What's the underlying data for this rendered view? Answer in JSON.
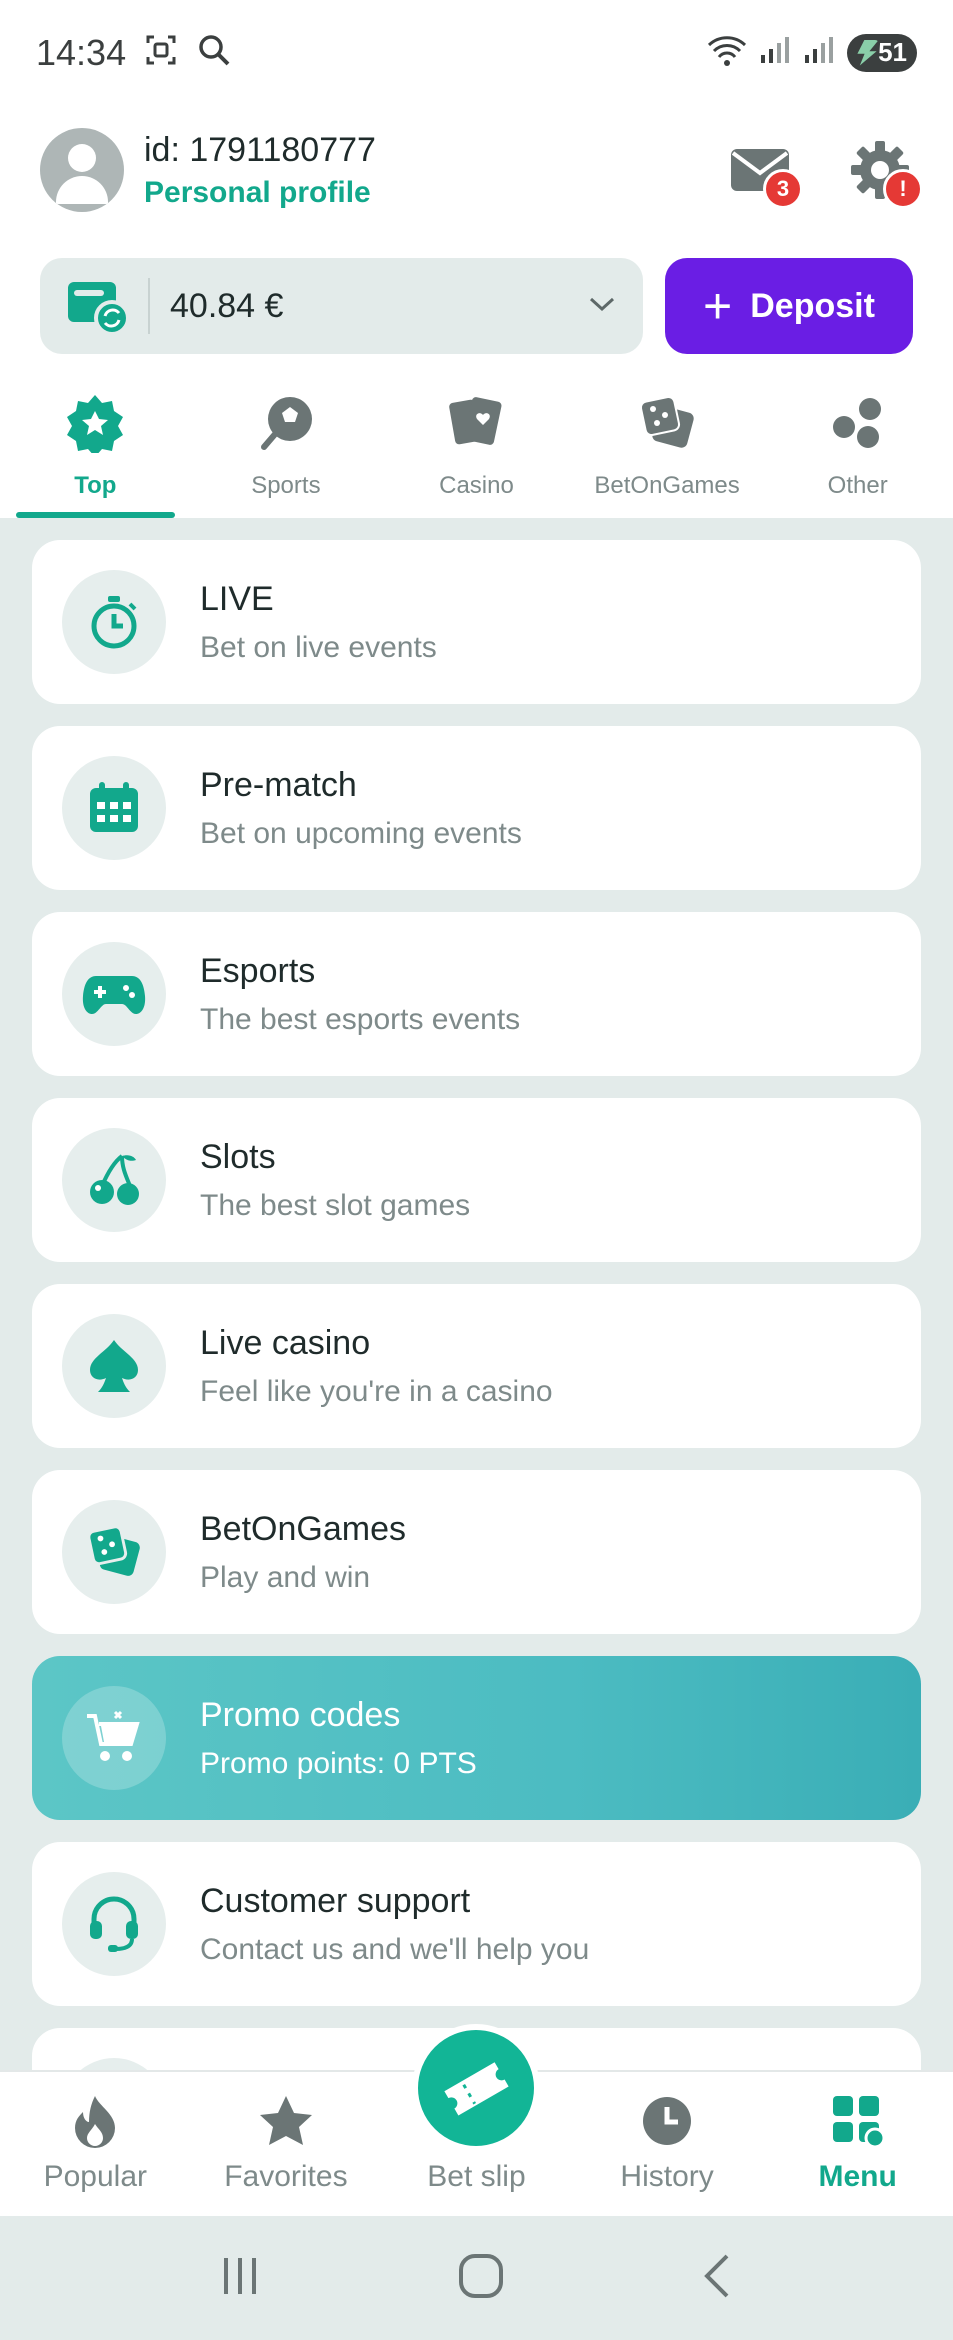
{
  "status_bar": {
    "time": "14:34",
    "battery": "51"
  },
  "header": {
    "user_id": "id: 1791180777",
    "profile_link": "Personal profile",
    "mail_badge": "3",
    "settings_badge": "!"
  },
  "balance": {
    "amount": "40.84 €",
    "deposit_label": "Deposit"
  },
  "tabs": [
    {
      "label": "Top",
      "icon": "star-badge-icon",
      "active": true
    },
    {
      "label": "Sports",
      "icon": "soccer-ball-icon",
      "active": false
    },
    {
      "label": "Casino",
      "icon": "cards-icon",
      "active": false
    },
    {
      "label": "BetOnGames",
      "icon": "dice-icon",
      "active": false
    },
    {
      "label": "Other",
      "icon": "dots-icon",
      "active": false
    }
  ],
  "menu_items": [
    {
      "title": "LIVE",
      "subtitle": "Bet on live events",
      "icon": "stopwatch-icon"
    },
    {
      "title": "Pre-match",
      "subtitle": "Bet on upcoming events",
      "icon": "calendar-icon"
    },
    {
      "title": "Esports",
      "subtitle": "The best esports events",
      "icon": "gamepad-icon"
    },
    {
      "title": "Slots",
      "subtitle": "The best slot games",
      "icon": "cherries-icon"
    },
    {
      "title": "Live casino",
      "subtitle": "Feel like you're in a casino",
      "icon": "spade-icon"
    },
    {
      "title": "BetOnGames",
      "subtitle": "Play and win",
      "icon": "dice-icon"
    },
    {
      "title": "Promo codes",
      "subtitle": "Promo points: 0 PTS",
      "icon": "cart-icon"
    },
    {
      "title": "Customer support",
      "subtitle": "Contact us and we'll help you",
      "icon": "headset-icon"
    }
  ],
  "bottom_nav": [
    {
      "label": "Popular",
      "icon": "flame-icon"
    },
    {
      "label": "Favorites",
      "icon": "star-icon"
    },
    {
      "label": "Bet slip",
      "icon": "ticket-icon"
    },
    {
      "label": "History",
      "icon": "clock-icon"
    },
    {
      "label": "Menu",
      "icon": "grid-icon"
    }
  ],
  "colors": {
    "accent": "#12a88c",
    "deposit": "#6a1ee4",
    "badge": "#e53935",
    "background": "#e3ebea"
  }
}
